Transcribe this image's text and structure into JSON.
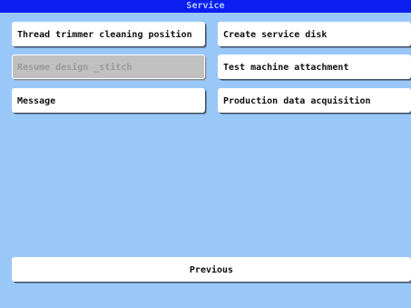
{
  "window": {
    "title": "Service",
    "background_color": "#99c8f8",
    "title_bar_color": "#0a1ff0"
  },
  "buttons": {
    "thread_trimmer": "Thread trimmer cleaning position",
    "create_disk": "Create service disk",
    "resume_design": "Resume design _stitch",
    "test_attachment": "Test machine attachment",
    "message": "Message",
    "production_data": "Production data acquisition",
    "previous": "Previous"
  },
  "states": {
    "resume_design_enabled": false
  }
}
